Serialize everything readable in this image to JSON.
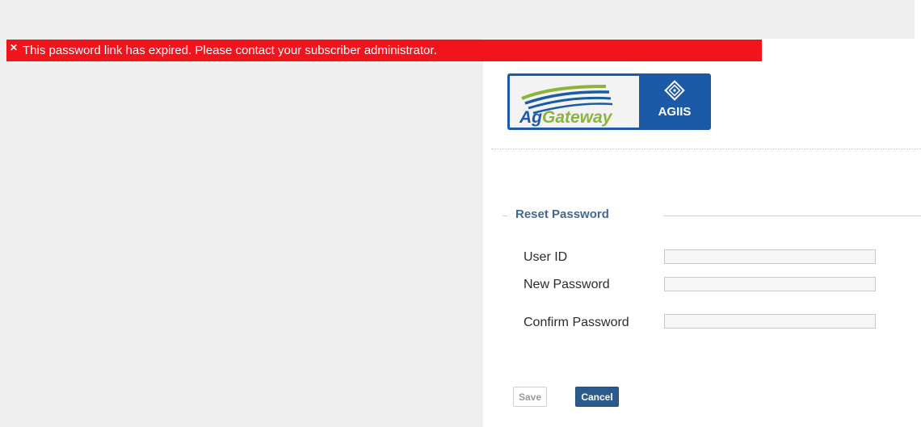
{
  "error": {
    "icon": "close-icon",
    "message": "This password link has expired. Please contact your subscriber administrator.",
    "color": "#f0141c"
  },
  "logo": {
    "left_text_prefix": "Ag",
    "left_text_suffix": "Gateway",
    "right_text": "AGIIS",
    "brand_blue": "#1b5aa6",
    "brand_green": "#8cb43c"
  },
  "form": {
    "legend": "Reset Password",
    "fields": [
      {
        "label": "User ID",
        "value": ""
      },
      {
        "label": "New Password",
        "value": ""
      },
      {
        "label": "Confirm Password",
        "value": ""
      }
    ]
  },
  "buttons": {
    "save_label": "Save",
    "cancel_label": "Cancel"
  }
}
